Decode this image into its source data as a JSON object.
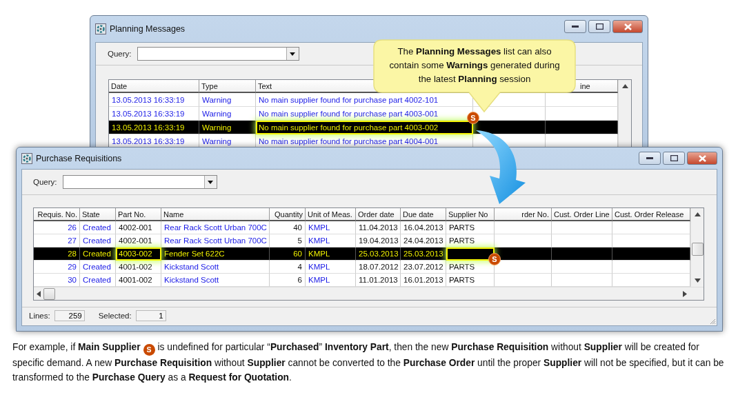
{
  "planning_window": {
    "title": "Planning Messages",
    "query_label": "Query:",
    "columns": [
      {
        "label": "Date",
        "kind": "link"
      },
      {
        "label": "Type",
        "kind": "link"
      },
      {
        "label": "Text",
        "kind": "link"
      },
      {
        "kind": "plain"
      },
      {
        "label": "ine",
        "kind": "plain"
      }
    ],
    "rows": [
      {
        "cells": [
          "13.05.2013 16:33:19",
          "Warning",
          "No main supplier found for purchase part 4002-101"
        ],
        "selected": false
      },
      {
        "cells": [
          "13.05.2013 16:33:19",
          "Warning",
          "No main supplier found for purchase part 4003-001"
        ],
        "selected": false
      },
      {
        "cells": [
          "13.05.2013 16:33:19",
          "Warning",
          {
            "text": "No main supplier found for purchase part 4003-002",
            "marked": true,
            "badge": "S"
          }
        ],
        "selected": true
      },
      {
        "cells": [
          "13.05.2013 16:33:19",
          "Warning",
          "No main supplier found for purchase part 4004-001"
        ],
        "selected": false
      }
    ]
  },
  "callout": {
    "text": "The **Planning  Messages** list can also contain some **Warnings** generated during the latest **Planning** session"
  },
  "requisitions_window": {
    "title": "Purchase Requisitions",
    "query_label": "Query:",
    "columns": [
      {
        "label": "Requis. No.",
        "kind": "link"
      },
      {
        "label": "State",
        "kind": "link"
      },
      {
        "label": "Part No.",
        "kind": "plain"
      },
      {
        "label": "Name",
        "kind": "link"
      },
      {
        "label": "Quantity",
        "kind": "plain"
      },
      {
        "label": "Unit of Meas.",
        "kind": "link"
      },
      {
        "label": "Order date",
        "kind": "plain"
      },
      {
        "label": "Due date",
        "kind": "plain"
      },
      {
        "label": "Supplier No",
        "kind": "plain"
      },
      {
        "label": "rder No.",
        "kind": "plain"
      },
      {
        "label": "Cust. Order Line",
        "kind": "plain"
      },
      {
        "label": "Cust. Order Release",
        "kind": "plain"
      }
    ],
    "rows": [
      {
        "cells": [
          "26",
          "Created",
          "4002-001",
          "Rear Rack Scott Urban 700C",
          "40",
          "KMPL",
          "11.04.2013",
          "16.04.2013",
          "PARTS"
        ],
        "selected": false
      },
      {
        "cells": [
          "27",
          "Created",
          "4002-001",
          "Rear Rack Scott Urban 700C",
          "5",
          "KMPL",
          "19.04.2013",
          "24.04.2013",
          "PARTS"
        ],
        "selected": false
      },
      {
        "cells": [
          "28",
          "Created",
          {
            "text": "4003-002",
            "marked": true
          },
          "Fender Set 622C",
          "60",
          "KMPL",
          "25.03.2013",
          "25.03.2013",
          {
            "marked": true,
            "badge": "S"
          }
        ],
        "selected": true
      },
      {
        "cells": [
          "29",
          "Created",
          "4001-002",
          "Kickstand Scott",
          "4",
          "KMPL",
          "18.07.2012",
          "23.07.2012",
          "PARTS"
        ],
        "selected": false
      },
      {
        "cells": [
          "30",
          "Created",
          "4001-002",
          "Kickstand Scott",
          "6",
          "KMPL",
          "11.01.2013",
          "16.01.2013",
          "PARTS"
        ],
        "selected": false
      }
    ],
    "status_bar": {
      "lines_label": "Lines:",
      "lines": "259",
      "selected_label": "Selected:",
      "selected_count": "1"
    }
  },
  "note": {
    "before": "For example, if **Main Supplier**",
    "badge": "S",
    "after": "is undefined for particular “**Purchased**” **Inventory Part**, then the new **Purchase Requisition** without **Supplier** will be created for specific demand.  A new **Purchase Requisition** without **Supplier** cannot be converted to the **Purchase Order** until the proper **Supplier** will not be specified, but it can be transformed to the **Purchase Query** as a **Request for Quotation**."
  }
}
